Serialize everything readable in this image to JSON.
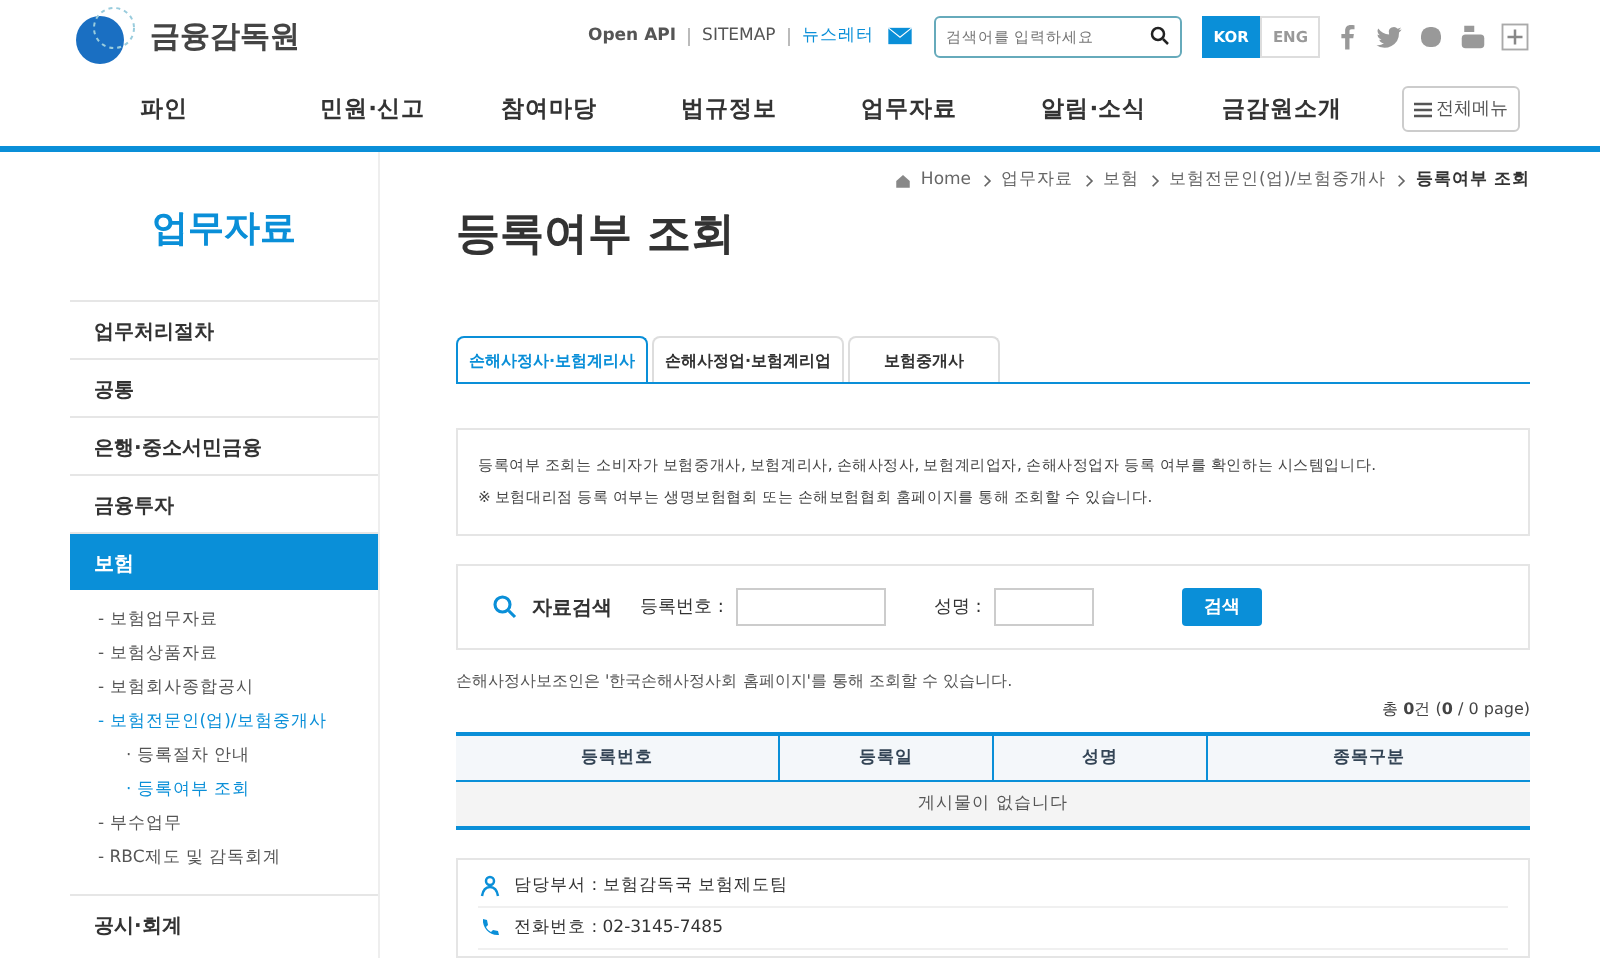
{
  "header": {
    "logo_text": "금융감독원",
    "open_api": "Open API",
    "sitemap": "SITEMAP",
    "newsletter": "뉴스레터",
    "search": {
      "placeholder": "검색어를 입력하세요"
    },
    "languages": [
      {
        "label": "KOR",
        "selected": true
      },
      {
        "label": "ENG",
        "selected": false
      }
    ]
  },
  "nav": {
    "items": [
      "파인",
      "민원·신고",
      "참여마당",
      "법규정보",
      "업무자료",
      "알림·소식",
      "금감원소개"
    ],
    "all_menu": "전체메뉴"
  },
  "sidebar": {
    "title": "업무자료",
    "items": [
      {
        "label": "업무처리절차",
        "selected": false
      },
      {
        "label": "공통",
        "selected": false
      },
      {
        "label": "은행·중소서민금융",
        "selected": false
      },
      {
        "label": "금융투자",
        "selected": false
      },
      {
        "label": "보험",
        "selected": true,
        "children": [
          {
            "marker": "-",
            "label": "보험업무자료",
            "selected": false
          },
          {
            "marker": "-",
            "label": "보험상품자료",
            "selected": false
          },
          {
            "marker": "-",
            "label": "보험회사종합공시",
            "selected": false
          },
          {
            "marker": "-",
            "label": "보험전문인(업)/보험중개사",
            "selected": true,
            "children": [
              {
                "marker": "·",
                "label": "등록절차 안내",
                "selected": false
              },
              {
                "marker": "·",
                "label": "등록여부 조회",
                "selected": true
              }
            ]
          },
          {
            "marker": "-",
            "label": "부수업무",
            "selected": false
          },
          {
            "marker": "-",
            "label": "RBC제도 및 감독회계",
            "selected": false
          }
        ]
      },
      {
        "label": "공시·회계",
        "selected": false
      }
    ]
  },
  "breadcrumb": [
    "Home",
    "업무자료",
    "보험",
    "보험전문인(업)/보험중개사",
    "등록여부 조회"
  ],
  "page_title": "등록여부 조회",
  "tabs": [
    {
      "label": "손해사정사·보험계리사",
      "selected": true
    },
    {
      "label": "손해사정업·보험계리업",
      "selected": false
    },
    {
      "label": "보험중개사",
      "selected": false
    }
  ],
  "info": [
    "등록여부 조회는 소비자가 보험중개사, 보험계리사, 손해사정사, 보험계리업자, 손해사정업자 등록 여부를 확인하는 시스템입니다.",
    "※ 보험대리점 등록 여부는 생명보험협회 또는 손해보험협회 홈페이지를 통해 조회할 수 있습니다."
  ],
  "search_form": {
    "title": "자료검색",
    "fields": [
      {
        "label": "등록번호 :"
      },
      {
        "label": "성명 :"
      }
    ],
    "button": "검색"
  },
  "note": "손해사정사보조인은 '한국손해사정사회 홈페이지'를 통해 조회할 수 있습니다.",
  "count": "총 **0**건 (**0** / 0 page)",
  "table": {
    "columns": [
      "등록번호",
      "등록일",
      "성명",
      "종목구분"
    ],
    "empty": "게시물이 없습니다"
  },
  "contact": [
    {
      "kind": "person",
      "text": "담당부서 : 보험감독국 보험제도팀"
    },
    {
      "kind": "phone",
      "text": "전화번호 : 02-3145-7485"
    }
  ]
}
